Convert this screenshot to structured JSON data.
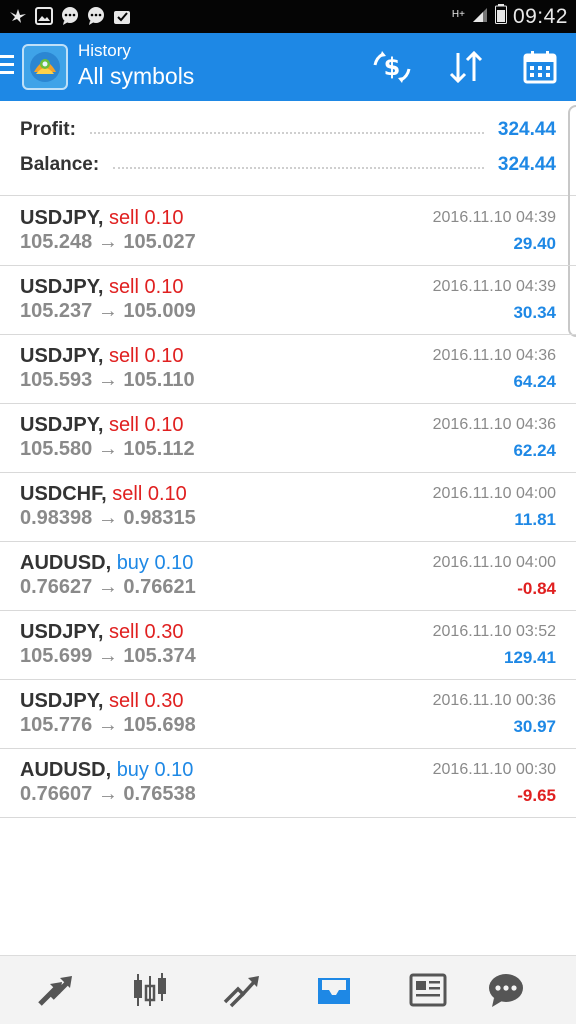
{
  "status_bar": {
    "network_label": "H+",
    "time": "09:42"
  },
  "app_bar": {
    "title": "History",
    "subtitle": "All symbols",
    "accent_color": "#1e88e5"
  },
  "summary": {
    "profit_label": "Profit:",
    "profit_value": "324.44",
    "balance_label": "Balance:",
    "balance_value": "324.44"
  },
  "deals": [
    {
      "symbol": "USDJPY",
      "side": "sell",
      "volume": "0.10",
      "open": "105.248",
      "close": "105.027",
      "time": "2016.11.10 04:39",
      "profit": "29.40"
    },
    {
      "symbol": "USDJPY",
      "side": "sell",
      "volume": "0.10",
      "open": "105.237",
      "close": "105.009",
      "time": "2016.11.10 04:39",
      "profit": "30.34"
    },
    {
      "symbol": "USDJPY",
      "side": "sell",
      "volume": "0.10",
      "open": "105.593",
      "close": "105.110",
      "time": "2016.11.10 04:36",
      "profit": "64.24"
    },
    {
      "symbol": "USDJPY",
      "side": "sell",
      "volume": "0.10",
      "open": "105.580",
      "close": "105.112",
      "time": "2016.11.10 04:36",
      "profit": "62.24"
    },
    {
      "symbol": "USDCHF",
      "side": "sell",
      "volume": "0.10",
      "open": "0.98398",
      "close": "0.98315",
      "time": "2016.11.10 04:00",
      "profit": "11.81"
    },
    {
      "symbol": "AUDUSD",
      "side": "buy",
      "volume": "0.10",
      "open": "0.76627",
      "close": "0.76621",
      "time": "2016.11.10 04:00",
      "profit": "-0.84"
    },
    {
      "symbol": "USDJPY",
      "side": "sell",
      "volume": "0.30",
      "open": "105.699",
      "close": "105.374",
      "time": "2016.11.10 03:52",
      "profit": "129.41"
    },
    {
      "symbol": "USDJPY",
      "side": "sell",
      "volume": "0.30",
      "open": "105.776",
      "close": "105.698",
      "time": "2016.11.10 00:36",
      "profit": "30.97"
    },
    {
      "symbol": "AUDUSD",
      "side": "buy",
      "volume": "0.10",
      "open": "0.76607",
      "close": "0.76538",
      "time": "2016.11.10 00:30",
      "profit": "-9.65"
    }
  ],
  "colors": {
    "sell": "#e02020",
    "buy": "#1e88e5",
    "profit_positive": "#1e88e5",
    "profit_negative": "#e02020"
  },
  "bottom_nav": [
    {
      "icon": "quotes-icon",
      "active": false
    },
    {
      "icon": "chart-icon",
      "active": false
    },
    {
      "icon": "trade-icon",
      "active": false
    },
    {
      "icon": "history-icon",
      "active": true
    },
    {
      "icon": "news-icon",
      "active": false
    },
    {
      "icon": "chat-icon",
      "active": false
    }
  ]
}
